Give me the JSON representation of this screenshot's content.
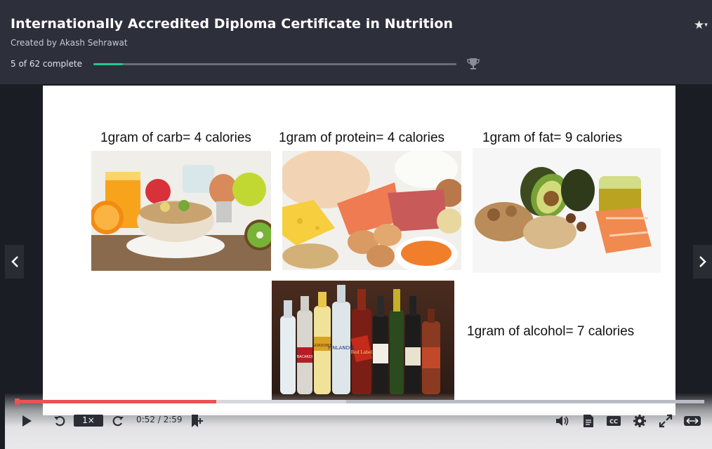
{
  "course": {
    "title": "Internationally Accredited Diploma Certificate in Nutrition",
    "creator": "Created by Akash Sehrawat",
    "progress_text": "5 of 62 complete",
    "completed": 5,
    "total": 62
  },
  "slide": {
    "captions": {
      "carb": "1gram of carb= 4 calories",
      "protein": "1gram of protein= 4 calories",
      "fat": "1gram of fat= 9 calories",
      "alcohol": "1gram of alcohol= 7 calories"
    },
    "bottle_labels": [
      "FINLANDIA",
      "Red Label",
      "GORDON'S",
      "BACARDI"
    ]
  },
  "player": {
    "speed": "1×",
    "time": "0:52 / 2:59",
    "current_seconds": 52,
    "duration_seconds": 179,
    "accent_color": "#ec5252",
    "progress_color": "#1ec98f"
  },
  "icons": {
    "star": "star-icon",
    "trophy": "trophy-icon",
    "prev": "chevron-left-icon",
    "next": "chevron-right-icon"
  }
}
